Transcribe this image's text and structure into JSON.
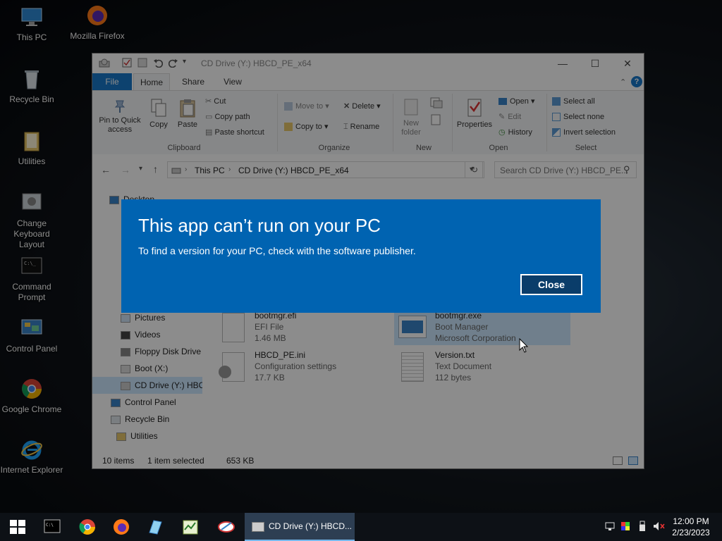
{
  "desktop": {
    "icons": [
      {
        "label": "This PC",
        "icon": "this-pc-icon"
      },
      {
        "label": "Mozilla Firefox",
        "icon": "firefox-icon"
      },
      {
        "label": "Recycle Bin",
        "icon": "recycle-bin-icon"
      },
      {
        "label": "Utilities",
        "icon": "folder-icon"
      },
      {
        "label": "Change Keyboard Layout",
        "icon": "keyboard-layout-icon"
      },
      {
        "label": "Command Prompt",
        "icon": "command-prompt-icon"
      },
      {
        "label": "Control Panel",
        "icon": "control-panel-icon"
      },
      {
        "label": "Google Chrome",
        "icon": "chrome-icon"
      },
      {
        "label": "Internet Explorer",
        "icon": "internet-explorer-icon"
      }
    ]
  },
  "explorer": {
    "title": "CD Drive (Y:) HBCD_PE_x64",
    "tabs": {
      "file": "File",
      "home": "Home",
      "share": "Share",
      "view": "View"
    },
    "ribbon": {
      "pin": "Pin to Quick access",
      "copy": "Copy",
      "paste": "Paste",
      "cut": "Cut",
      "copy_path": "Copy path",
      "paste_shortcut": "Paste shortcut",
      "clipboard": "Clipboard",
      "move_to": "Move to",
      "copy_to": "Copy to",
      "delete": "Delete",
      "rename": "Rename",
      "organize": "Organize",
      "new_folder": "New folder",
      "new": "New",
      "properties": "Properties",
      "open": "Open",
      "edit": "Edit",
      "history": "History",
      "open_group": "Open",
      "select_all": "Select all",
      "select_none": "Select none",
      "invert_selection": "Invert selection",
      "select_group": "Select"
    },
    "address": {
      "this_pc": "This PC",
      "drive": "CD Drive (Y:) HBCD_PE_x64",
      "search_placeholder": "Search CD Drive (Y:) HBCD_PE..."
    },
    "nav": {
      "desktop": "Desktop",
      "pictures": "Pictures",
      "videos": "Videos",
      "floppy": "Floppy Disk Drive",
      "boot": "Boot (X:)",
      "cd": "CD Drive (Y:) HBC",
      "control_panel": "Control Panel",
      "recycle_bin": "Recycle Bin",
      "utilities": "Utilities"
    },
    "files": [
      {
        "name": "bootmgr.efi",
        "type": "EFI File",
        "size": "1.46 MB"
      },
      {
        "name": "bootmgr.exe",
        "type": "Boot Manager",
        "size": "Microsoft Corporation"
      },
      {
        "name": "HBCD_PE.ini",
        "type": "Configuration settings",
        "size": "17.7 KB"
      },
      {
        "name": "Version.txt",
        "type": "Text Document",
        "size": "112 bytes"
      }
    ],
    "status": {
      "items": "10 items",
      "selected": "1 item selected",
      "size": "653 KB"
    }
  },
  "dialog": {
    "title": "This app can’t run on your PC",
    "message": "To find a version for your PC, check with the software publisher.",
    "close_label": "Close"
  },
  "taskbar": {
    "active_window": "CD Drive (Y:) HBCD...",
    "time": "12:00 PM",
    "date": "2/23/2023"
  },
  "colors": {
    "dialog_bg": "#0063b1",
    "file_tab": "#1979ca",
    "taskbar": "#0d1116"
  }
}
